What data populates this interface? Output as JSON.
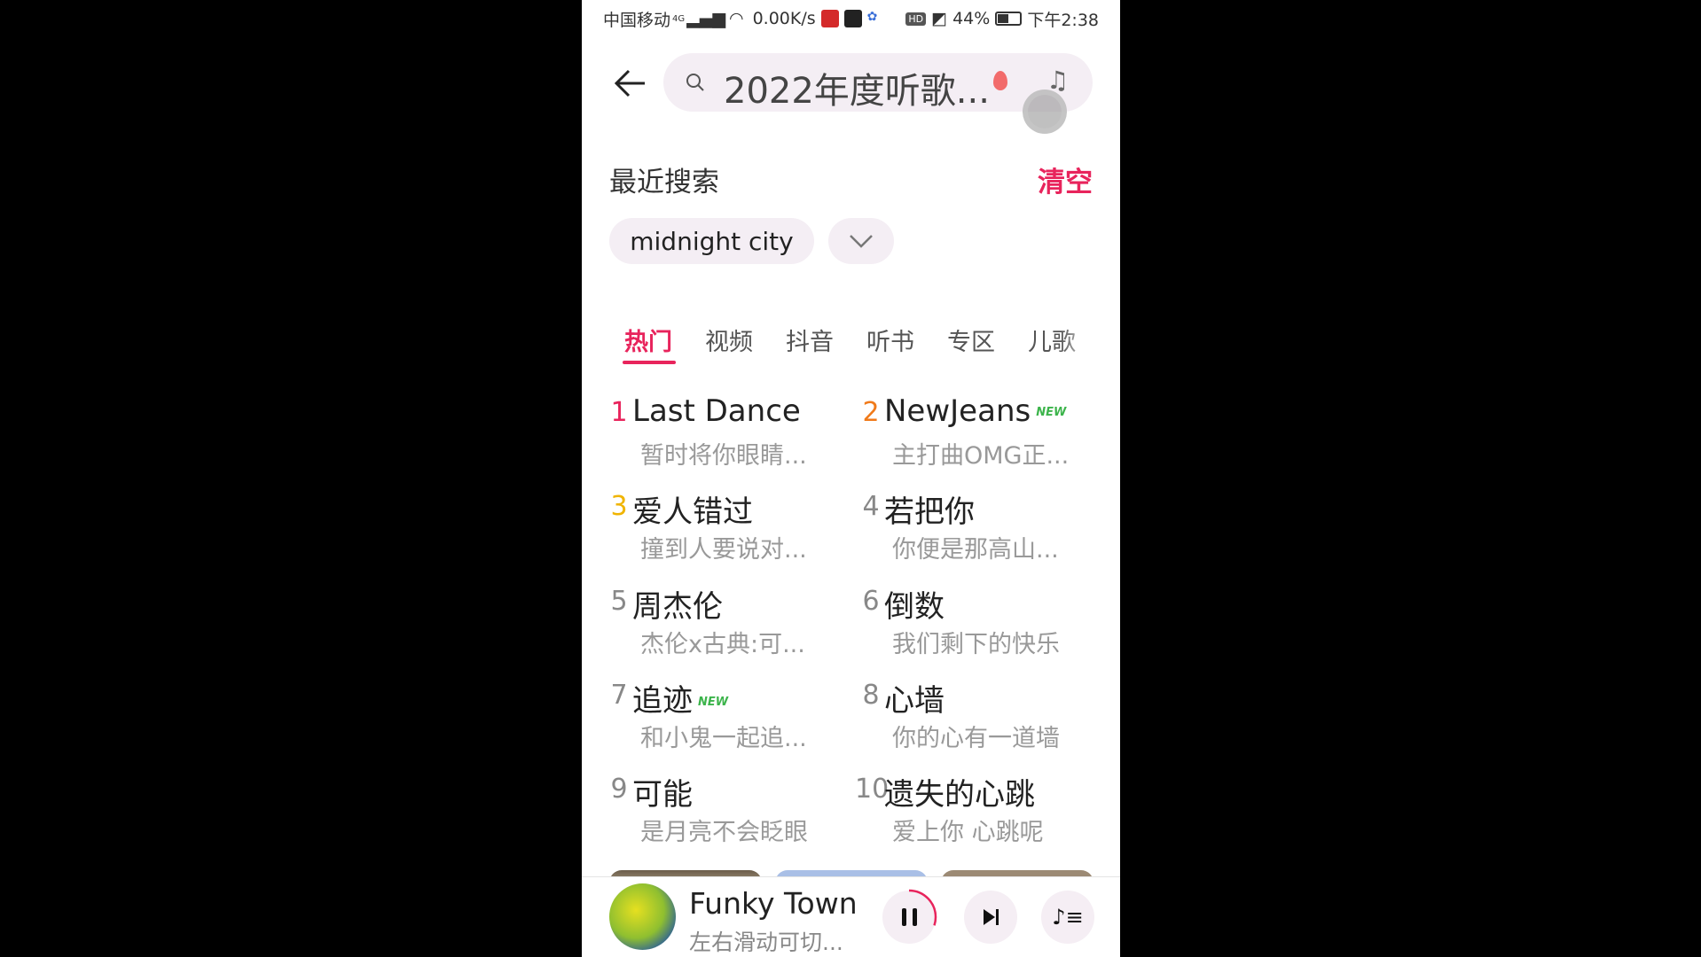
{
  "status_bar": {
    "carrier": "中国移动",
    "network": "4G",
    "speed": "0.00K/s",
    "battery": "44%",
    "time": "下午2:38"
  },
  "search": {
    "value": "2022年度听歌...",
    "icons": [
      "back-arrow-icon",
      "search-icon",
      "fire-icon",
      "music-recognition-icon"
    ]
  },
  "recent": {
    "heading": "最近搜索",
    "clear_label": "清空",
    "chips": [
      "midnight city"
    ]
  },
  "tabs": [
    {
      "label": "热门",
      "active": true
    },
    {
      "label": "视频"
    },
    {
      "label": "抖音"
    },
    {
      "label": "听书"
    },
    {
      "label": "专区"
    },
    {
      "label": "儿歌"
    }
  ],
  "hot_list": [
    {
      "rank": "1",
      "title": "Last Dance",
      "subtitle": "暂时将你眼睛...",
      "new": false,
      "color": "#e8245c"
    },
    {
      "rank": "2",
      "title": "NewJeans",
      "subtitle": "主打曲OMG正...",
      "new": true,
      "color": "#f07a1a"
    },
    {
      "rank": "3",
      "title": "爱人错过",
      "subtitle": "撞到人要说对...",
      "new": false,
      "color": "#f0b400"
    },
    {
      "rank": "4",
      "title": "若把你",
      "subtitle": "你便是那高山...",
      "new": false,
      "color": "#888888"
    },
    {
      "rank": "5",
      "title": "周杰伦",
      "subtitle": "杰伦x古典:可...",
      "new": false,
      "color": "#888888"
    },
    {
      "rank": "6",
      "title": "倒数",
      "subtitle": "我们剩下的快乐",
      "new": false,
      "color": "#888888"
    },
    {
      "rank": "7",
      "title": "追迹",
      "subtitle": "和小鬼一起追...",
      "new": true,
      "color": "#888888"
    },
    {
      "rank": "8",
      "title": "心墙",
      "subtitle": "你的心有一道墙",
      "new": false,
      "color": "#888888"
    },
    {
      "rank": "9",
      "title": "可能",
      "subtitle": "是月亮不会眨眼",
      "new": false,
      "color": "#888888"
    },
    {
      "rank": "10",
      "title": "遗失的心跳",
      "subtitle": "爱上你 心跳呢",
      "new": false,
      "color": "#888888"
    }
  ],
  "new_badge": "NEW",
  "player": {
    "title": "Funky Town",
    "subtitle": "左右滑动可切...",
    "progress": 0.3
  },
  "colors": {
    "accent": "#e8245c",
    "background": "#ffffff"
  }
}
